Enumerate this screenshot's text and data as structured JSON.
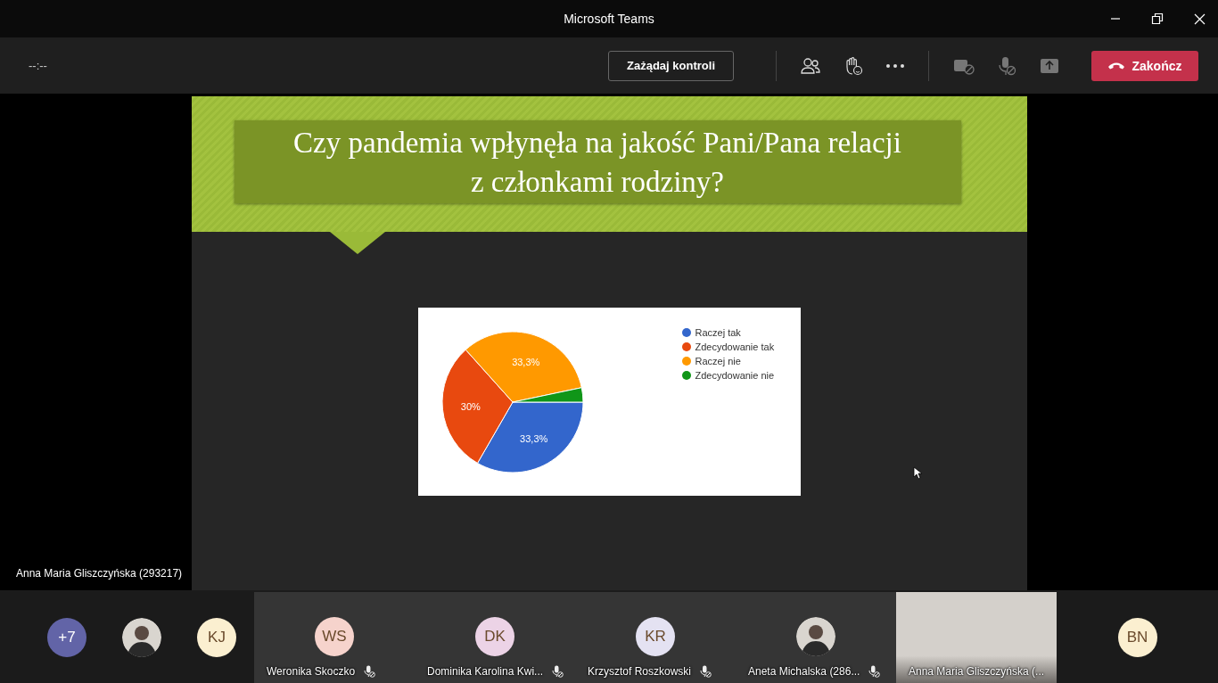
{
  "window": {
    "title": "Microsoft Teams"
  },
  "toolbar": {
    "timer": "--:--",
    "request_control": "Zażądaj kontroli",
    "end_call": "Zakończ"
  },
  "stage": {
    "speaker_name": "Anna Maria Gliszczyńska (293217)",
    "slide": {
      "title_lines": [
        "Czy pandemia wpłynęła na jakość Pani/Pana relacji",
        "z członkami rodziny?"
      ],
      "chart_data": {
        "type": "pie",
        "categories": [
          "Raczej tak",
          "Zdecydowanie tak",
          "Raczej nie",
          "Zdecydowanie nie"
        ],
        "values": [
          33.3,
          30,
          33.3,
          3.3
        ],
        "colors": [
          "#3366cc",
          "#e8490f",
          "#ff9900",
          "#109618"
        ],
        "value_labels": [
          "33,3%",
          "30%",
          "33,3%",
          null
        ],
        "legend": "right"
      }
    }
  },
  "participants": [
    {
      "kind": "overflow",
      "label": "+7",
      "color": "#6264a7"
    },
    {
      "kind": "photo"
    },
    {
      "kind": "initials",
      "label": "KJ",
      "color": "#fbefd0"
    },
    {
      "kind": "initials",
      "label": "WS",
      "color": "#f6d3cc",
      "name": "Weronika Skoczko",
      "muted": true
    },
    {
      "kind": "initials",
      "label": "DK",
      "color": "#ecd3e6",
      "name": "Dominika Karolina Kwi...",
      "muted": true
    },
    {
      "kind": "initials",
      "label": "KR",
      "color": "#e4e2f2",
      "name": "Krzysztof Roszkowski",
      "muted": true
    },
    {
      "kind": "photo",
      "name": "Aneta Michalska (286...",
      "muted": true
    },
    {
      "kind": "video",
      "name": "Anna Maria Gliszczyńska (...",
      "muted": false
    },
    {
      "kind": "initials",
      "label": "BN",
      "color": "#fbefd0"
    }
  ]
}
